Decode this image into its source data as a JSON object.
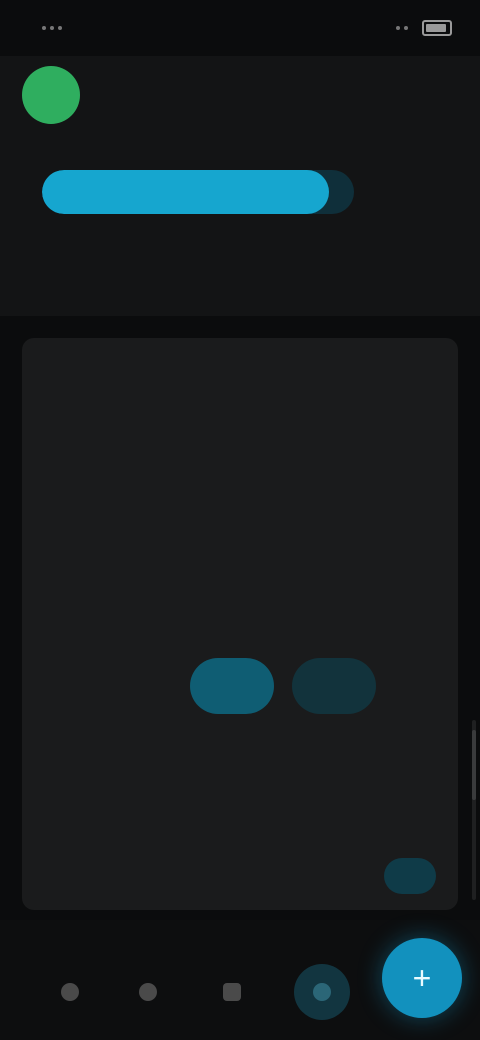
{
  "status_bar": {
    "time": "",
    "battery_icon": "battery-icon",
    "signal_icon": "signal-icon"
  },
  "account": {
    "avatar_initial": "",
    "name": "",
    "meta": "",
    "sub": ""
  },
  "progress": {
    "fraction": 0.92,
    "value_text": "",
    "footnote": ""
  },
  "main_card": {
    "section_title": "",
    "section_action": "",
    "row_title": "",
    "row_detail": "",
    "sub_heading": "",
    "toggle_left": "",
    "toggle_right": "",
    "footnote": "",
    "link_label": ""
  },
  "bottom_nav": {
    "items": [
      {
        "icon": "home-icon"
      },
      {
        "icon": "search-icon"
      },
      {
        "icon": "list-icon"
      },
      {
        "icon": "activity-icon"
      }
    ],
    "fab_icon": "plus-icon",
    "fab_label": "+"
  },
  "colors": {
    "accent": "#16a6cf",
    "avatar_green": "#2fae5f",
    "background": "#0b0c0d",
    "card": "#1a1b1c"
  }
}
